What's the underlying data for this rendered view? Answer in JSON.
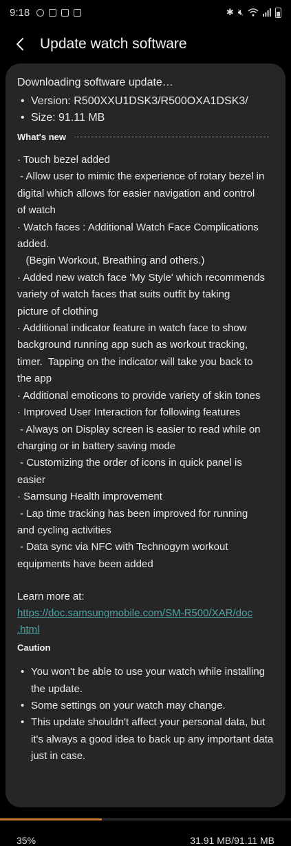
{
  "status_bar": {
    "time": "9:18",
    "right_icons": [
      "bluetooth-icon",
      "mute-icon",
      "wifi-icon",
      "signal-icon",
      "battery-icon"
    ]
  },
  "header": {
    "title": "Update watch software",
    "back_icon": "back-arrow-icon"
  },
  "download": {
    "status": "Downloading software update…",
    "details": [
      "Version: R500XXU1DSK3/R500OXA1DSK3/",
      "Size: 91.11 MB"
    ]
  },
  "whats_new": {
    "heading": "What's new",
    "lines": [
      "· Touch bezel added",
      " - Allow user to mimic the experience of rotary bezel in",
      "digital which allows for easier navigation and control",
      "of watch",
      "· Watch faces : Additional Watch Face Complications",
      "added.",
      "   (Begin Workout, Breathing and others.)",
      "· Added new watch face 'My Style' which recommends",
      "variety of watch faces that suits outfit by taking",
      "picture of clothing",
      "· Additional indicator feature in watch face to show",
      "background running app such as workout tracking,",
      "timer.  Tapping on the indicator will take you back to",
      "the app",
      "· Additional emoticons to provide variety of skin tones",
      "· Improved User Interaction for following features",
      " - Always on Display screen is easier to read while on",
      "charging or in battery saving mode",
      " - Customizing the order of icons in quick panel is",
      "easier",
      "· Samsung Health improvement",
      " - Lap time tracking has been improved for running",
      "and cycling activities",
      " - Data sync via NFC with Technogym workout",
      "equipments have been added"
    ],
    "learn_more_label": "Learn more at:",
    "link_line1": "https://doc.samsungmobile.com/SM-R500/XAR/doc",
    "link_line2": ".html"
  },
  "caution": {
    "heading": "Caution",
    "items": [
      "You won't be able to use your watch while installing the update.",
      "Some settings on your watch may change.",
      "This update shouldn't affect your personal data, but it's always a good idea to back up any important data just in case."
    ]
  },
  "progress": {
    "percent_label": "35%",
    "percent_value": 0.35,
    "size_label": "31.91 MB/91.11 MB",
    "color": "#c97a2e"
  }
}
